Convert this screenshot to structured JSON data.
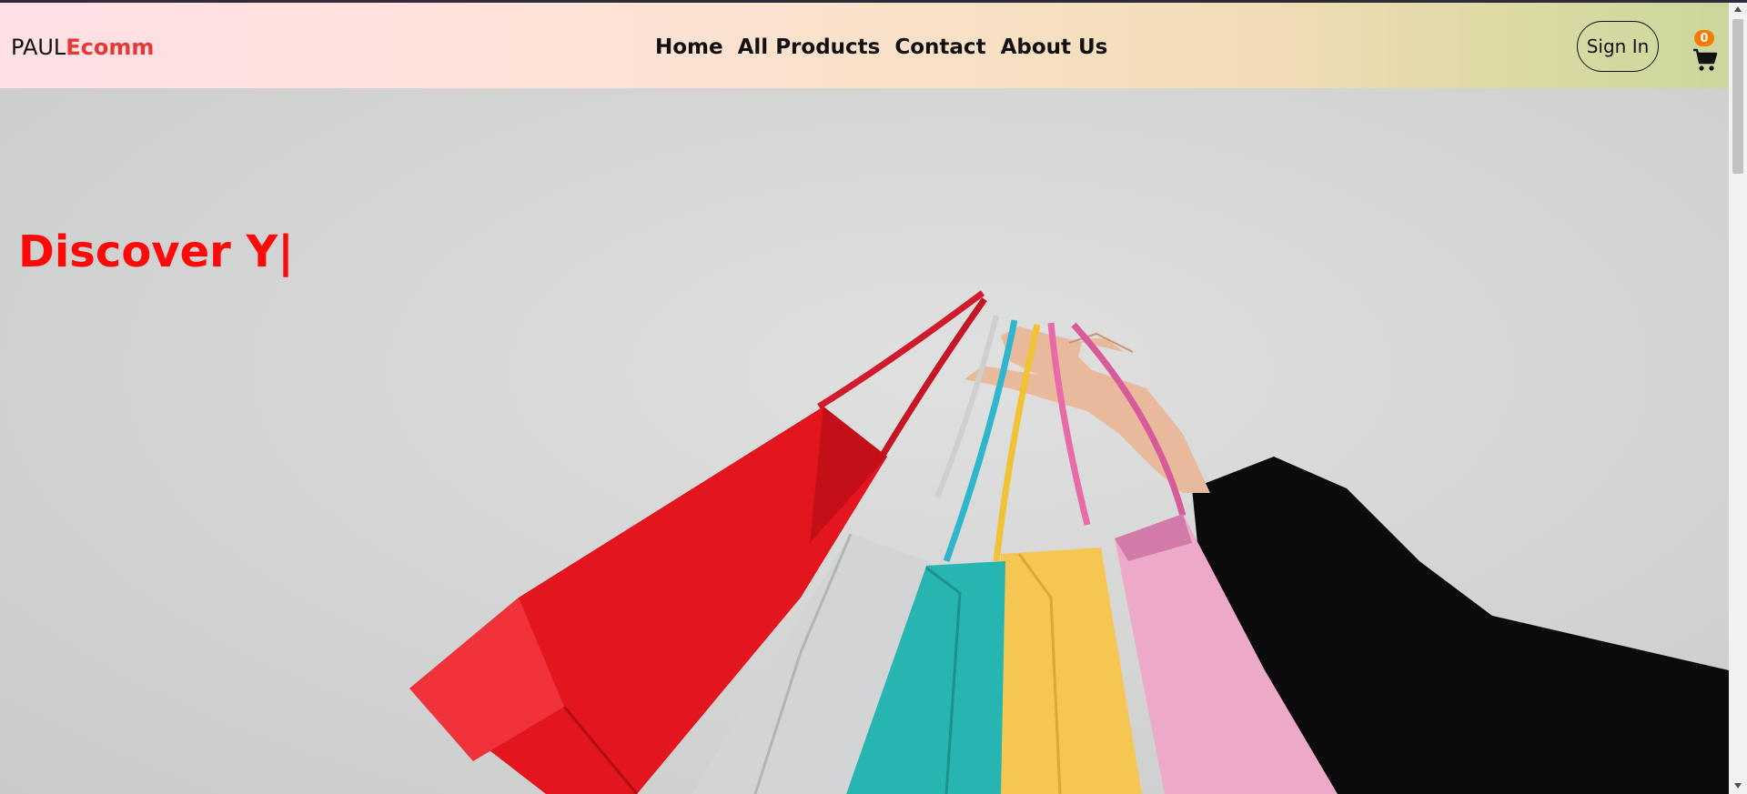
{
  "brand": {
    "prefix": "PAUL",
    "suffix": "Ecomm",
    "accent_color": "#e53935"
  },
  "nav": {
    "links": [
      {
        "label": "Home"
      },
      {
        "label": "All Products"
      },
      {
        "label": "Contact"
      },
      {
        "label": "About Us"
      }
    ]
  },
  "auth": {
    "signin_label": "Sign In"
  },
  "cart": {
    "count": "0",
    "icon": "cart-icon",
    "badge_color": "#f57c00"
  },
  "hero": {
    "headline": "Discover Y|",
    "headline_color": "#ff0a0a",
    "image": "hand-holding-shopping-bags"
  }
}
